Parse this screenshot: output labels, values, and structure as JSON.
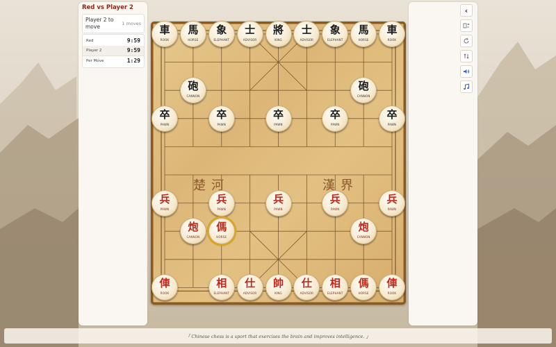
{
  "game": {
    "title": "Red vs Player 2",
    "turn": "Player 2 to move",
    "moves": "1 moves"
  },
  "timers": [
    {
      "label": "Red",
      "value": "9:59"
    },
    {
      "label": "Player 2",
      "value": "9:59"
    },
    {
      "label": "Per Move",
      "value": "1:29"
    }
  ],
  "controls": [
    "collapse-panel",
    "flip-board",
    "restart",
    "swap-sides",
    "sound",
    "music"
  ],
  "river": {
    "left": "楚河",
    "right": "漢界"
  },
  "pieces": [
    {
      "side": "black",
      "char": "車",
      "name": "ROOK",
      "file": 0,
      "rank": 0
    },
    {
      "side": "black",
      "char": "馬",
      "name": "HORSE",
      "file": 1,
      "rank": 0
    },
    {
      "side": "black",
      "char": "象",
      "name": "ELEPHANT",
      "file": 2,
      "rank": 0
    },
    {
      "side": "black",
      "char": "士",
      "name": "ADVISOR",
      "file": 3,
      "rank": 0
    },
    {
      "side": "black",
      "char": "將",
      "name": "KING",
      "file": 4,
      "rank": 0
    },
    {
      "side": "black",
      "char": "士",
      "name": "ADVISOR",
      "file": 5,
      "rank": 0
    },
    {
      "side": "black",
      "char": "象",
      "name": "ELEPHANT",
      "file": 6,
      "rank": 0
    },
    {
      "side": "black",
      "char": "馬",
      "name": "HORSE",
      "file": 7,
      "rank": 0
    },
    {
      "side": "black",
      "char": "車",
      "name": "ROOK",
      "file": 8,
      "rank": 0
    },
    {
      "side": "black",
      "char": "砲",
      "name": "CANNON",
      "file": 1,
      "rank": 2
    },
    {
      "side": "black",
      "char": "砲",
      "name": "CANNON",
      "file": 7,
      "rank": 2
    },
    {
      "side": "black",
      "char": "卒",
      "name": "PAWN",
      "file": 0,
      "rank": 3
    },
    {
      "side": "black",
      "char": "卒",
      "name": "PAWN",
      "file": 2,
      "rank": 3
    },
    {
      "side": "black",
      "char": "卒",
      "name": "PAWN",
      "file": 4,
      "rank": 3
    },
    {
      "side": "black",
      "char": "卒",
      "name": "PAWN",
      "file": 6,
      "rank": 3
    },
    {
      "side": "black",
      "char": "卒",
      "name": "PAWN",
      "file": 8,
      "rank": 3
    },
    {
      "side": "red",
      "char": "兵",
      "name": "PAWN",
      "file": 0,
      "rank": 6
    },
    {
      "side": "red",
      "char": "兵",
      "name": "PAWN",
      "file": 2,
      "rank": 6
    },
    {
      "side": "red",
      "char": "兵",
      "name": "PAWN",
      "file": 4,
      "rank": 6
    },
    {
      "side": "red",
      "char": "兵",
      "name": "PAWN",
      "file": 6,
      "rank": 6
    },
    {
      "side": "red",
      "char": "兵",
      "name": "PAWN",
      "file": 8,
      "rank": 6
    },
    {
      "side": "red",
      "char": "炮",
      "name": "CANNON",
      "file": 1,
      "rank": 7
    },
    {
      "side": "red",
      "char": "傌",
      "name": "HORSE",
      "file": 2,
      "rank": 7,
      "selected": true
    },
    {
      "side": "red",
      "char": "炮",
      "name": "CANNON",
      "file": 7,
      "rank": 7
    },
    {
      "side": "red",
      "char": "俥",
      "name": "ROOK",
      "file": 0,
      "rank": 9
    },
    {
      "side": "red",
      "char": "相",
      "name": "ELEPHANT",
      "file": 2,
      "rank": 9
    },
    {
      "side": "red",
      "char": "仕",
      "name": "ADVISOR",
      "file": 3,
      "rank": 9
    },
    {
      "side": "red",
      "char": "帥",
      "name": "KING",
      "file": 4,
      "rank": 9
    },
    {
      "side": "red",
      "char": "仕",
      "name": "ADVISOR",
      "file": 5,
      "rank": 9
    },
    {
      "side": "red",
      "char": "相",
      "name": "ELEPHANT",
      "file": 6,
      "rank": 9
    },
    {
      "side": "red",
      "char": "傌",
      "name": "HORSE",
      "file": 7,
      "rank": 9
    },
    {
      "side": "red",
      "char": "俥",
      "name": "ROOK",
      "file": 8,
      "rank": 9
    }
  ],
  "footer": "「 Chinese chess is a sport that exercises the brain and improves intelligence. 」",
  "colors": {
    "red_piece": "#c0281b",
    "black_piece": "#1a1a1a",
    "title": "#8b2a1a",
    "selection": "#d9a520"
  }
}
